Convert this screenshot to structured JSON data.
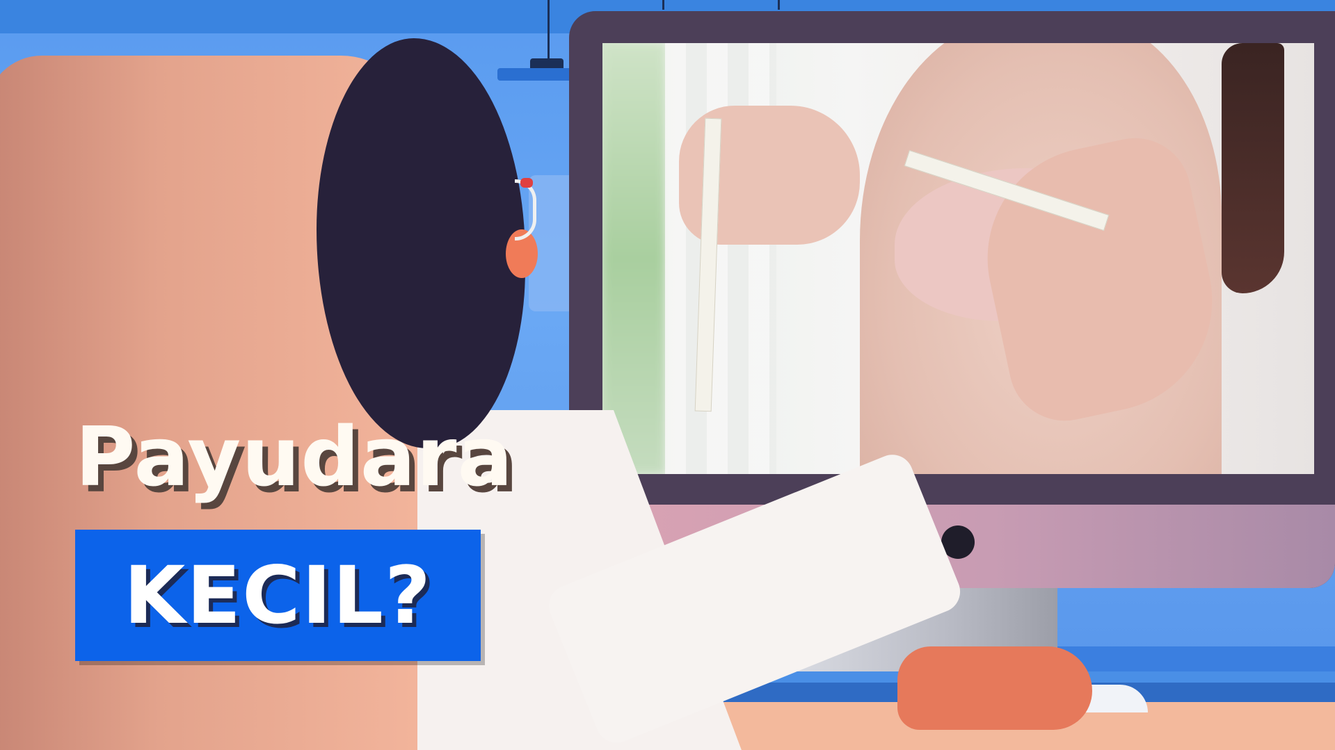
{
  "title": {
    "line1": "Payudara",
    "line2": "KECIL?"
  },
  "colors": {
    "background": "#4a8fe6",
    "monitor_frame": "#4c3f58",
    "title_box": "#0c63ea",
    "title_text": "#fffaf2",
    "title_shadow": "#58463f"
  }
}
